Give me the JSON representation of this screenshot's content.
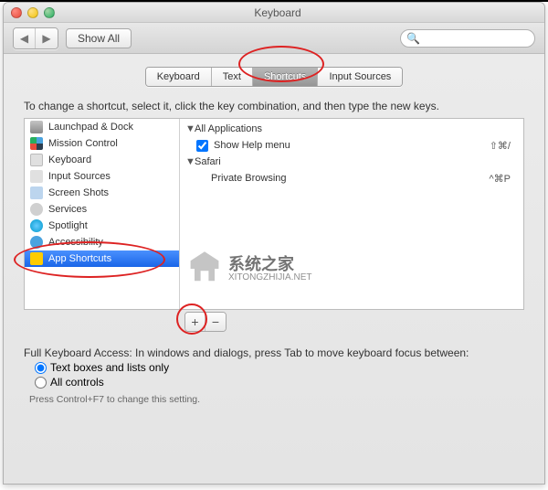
{
  "window": {
    "title": "Keyboard"
  },
  "toolbar": {
    "show_all": "Show All",
    "search_placeholder": ""
  },
  "tabs": {
    "items": [
      "Keyboard",
      "Text",
      "Shortcuts",
      "Input Sources"
    ],
    "selected_index": 2
  },
  "instruction": "To change a shortcut, select it, click the key combination, and then type the new keys.",
  "categories": [
    {
      "label": "Launchpad & Dock",
      "icon": "launchpad"
    },
    {
      "label": "Mission Control",
      "icon": "mission"
    },
    {
      "label": "Keyboard",
      "icon": "keyboard"
    },
    {
      "label": "Input Sources",
      "icon": "input"
    },
    {
      "label": "Screen Shots",
      "icon": "screen"
    },
    {
      "label": "Services",
      "icon": "services"
    },
    {
      "label": "Spotlight",
      "icon": "spotlight"
    },
    {
      "label": "Accessibility",
      "icon": "acc"
    },
    {
      "label": "App Shortcuts",
      "icon": "app"
    }
  ],
  "categories_selected_index": 8,
  "shortcuts": {
    "groups": [
      {
        "name": "All Applications",
        "items": [
          {
            "label": "Show Help menu",
            "keys": "⇧⌘/",
            "checked": true
          }
        ]
      },
      {
        "name": "Safari",
        "items": [
          {
            "label": "Private Browsing",
            "keys": "^⌘P",
            "checked": false
          }
        ]
      }
    ]
  },
  "buttons": {
    "add": "+",
    "remove": "−"
  },
  "fka": {
    "label": "Full Keyboard Access: In windows and dialogs, press Tab to move keyboard focus between:",
    "opt1": "Text boxes and lists only",
    "opt2": "All controls",
    "selected": 0,
    "hint": "Press Control+F7 to change this setting."
  },
  "watermark": {
    "title": "系统之家",
    "sub": "XITONGZHIJIA.NET"
  }
}
